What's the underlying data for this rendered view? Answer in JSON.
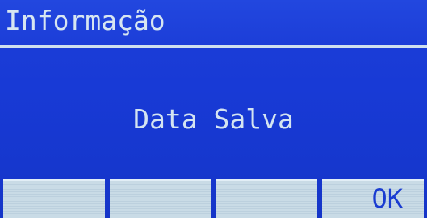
{
  "dialog": {
    "title": "Informação",
    "message": "Data Salva"
  },
  "softkeys": [
    {
      "label": ""
    },
    {
      "label": ""
    },
    {
      "label": ""
    },
    {
      "label": "OK"
    }
  ],
  "colors": {
    "background": "#1a3bd4",
    "text": "#d7e6f1",
    "softkey_background": "#c9dbe6",
    "softkey_text": "#1a3cd1"
  }
}
